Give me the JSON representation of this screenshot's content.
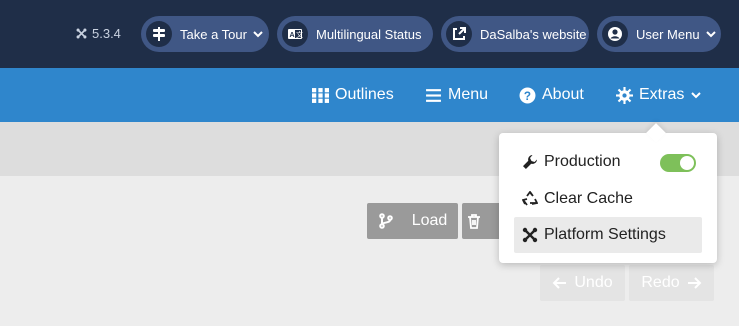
{
  "header": {
    "version": "5.3.4",
    "pills": [
      {
        "label": "Take a Tour",
        "icon": "signpost-icon"
      },
      {
        "label": "Multilingual Status",
        "icon": "language-icon"
      },
      {
        "label": "DaSalba's website",
        "icon": "external-link-icon"
      },
      {
        "label": "User Menu",
        "icon": "user-circle-icon"
      }
    ]
  },
  "nav": {
    "items": [
      {
        "label": "Outlines",
        "icon": "grid-icon"
      },
      {
        "label": "Menu",
        "icon": "bars-icon"
      },
      {
        "label": "About",
        "icon": "question-circle-icon"
      },
      {
        "label": "Extras",
        "icon": "gear-icon"
      }
    ]
  },
  "dropdown": {
    "items": [
      {
        "label": "Production",
        "icon": "wrench-icon",
        "toggle": true
      },
      {
        "label": "Clear Cache",
        "icon": "recycle-icon"
      },
      {
        "label": "Platform Settings",
        "icon": "joomla-icon"
      }
    ]
  },
  "toolbar": {
    "load_label": "Load",
    "undo_label": "Undo",
    "redo_label": "Redo"
  },
  "colors": {
    "header_bg": "#1f2e48",
    "pill_bg": "#405785",
    "nav_bg": "#2f86cc",
    "toggle_on": "#7ec05a"
  }
}
